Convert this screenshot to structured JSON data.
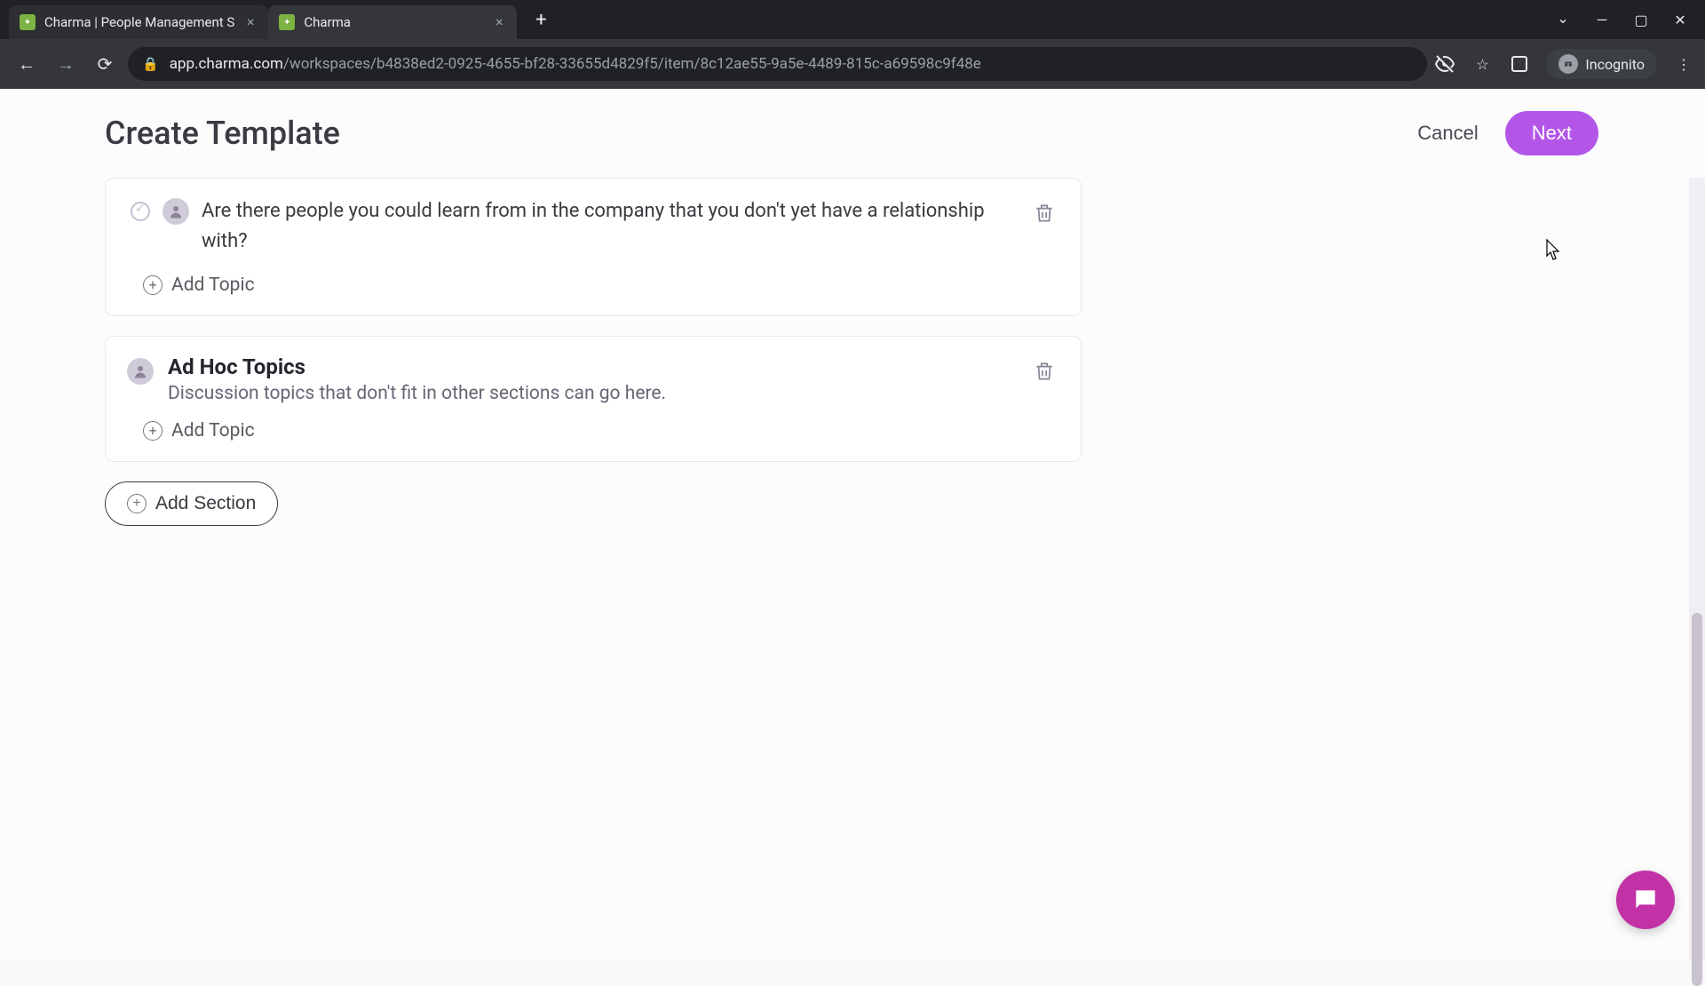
{
  "browser": {
    "tabs": [
      {
        "title": "Charma | People Management S",
        "active": false
      },
      {
        "title": "Charma",
        "active": true
      }
    ],
    "url_host": "app.charma.com",
    "url_path": "/workspaces/b4838ed2-0925-4655-bf28-33655d4829f5/item/8c12ae55-9a5e-4489-815c-a69598c9f48e",
    "incognito_label": "Incognito"
  },
  "header": {
    "title": "Create Template",
    "cancel_label": "Cancel",
    "next_label": "Next"
  },
  "sections": [
    {
      "topics": [
        "Are there people you could learn from in the company that you don't yet have a relationship with?"
      ],
      "add_topic_label": "Add Topic"
    },
    {
      "title": "Ad Hoc Topics",
      "description": "Discussion topics that don't fit in other sections can go here.",
      "add_topic_label": "Add Topic"
    }
  ],
  "add_section_label": "Add Section"
}
